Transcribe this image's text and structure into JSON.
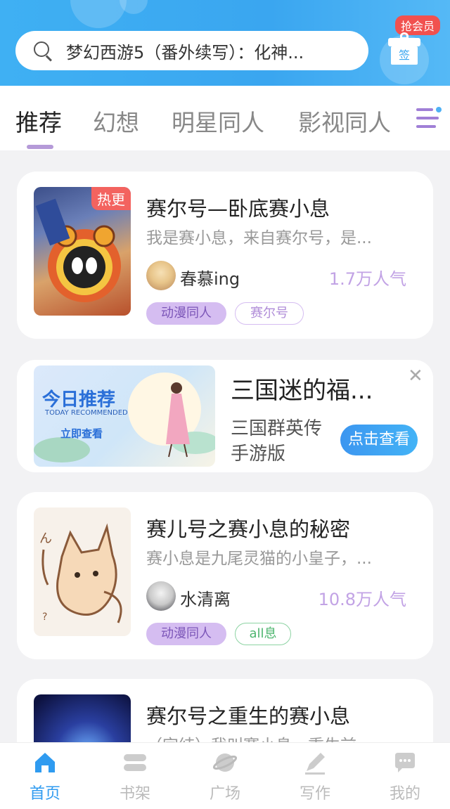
{
  "header": {
    "search_text": "梦幻西游5（番外续写）：化神...",
    "vip_badge": "抢会员",
    "sign_label": "签"
  },
  "tabs": [
    {
      "label": "推荐",
      "active": true
    },
    {
      "label": "幻想",
      "active": false
    },
    {
      "label": "明星同人",
      "active": false
    },
    {
      "label": "影视同人",
      "active": false
    }
  ],
  "books": [
    {
      "title": "赛尔号—卧底赛小息",
      "desc": "我是赛小息，来自赛尔号，是...",
      "badge": "热更",
      "author": "春慕ing",
      "popularity": "1.7万人气",
      "tags": [
        "动漫同人",
        "赛尔号"
      ]
    },
    {
      "title": "赛儿号之赛小息的秘密",
      "desc": "赛小息是九尾灵猫的小皇子，...",
      "author": "水清离",
      "popularity": "10.8万人气",
      "tags": [
        "动漫同人",
        "all息"
      ]
    },
    {
      "title": "赛尔号之重生的赛小息",
      "desc": "（完结）我叫赛小息，重生前..."
    }
  ],
  "ad": {
    "banner_title": "今日推荐",
    "banner_subtitle": "TODAY RECOMMENDED",
    "banner_cta": "立即查看",
    "title": "三国迷的福...",
    "subtitle": "三国群英传手游版",
    "button": "点击查看",
    "close": "✕"
  },
  "bottom_nav": [
    {
      "label": "首页",
      "icon": "home-icon",
      "active": true
    },
    {
      "label": "书架",
      "icon": "bookshelf-icon",
      "active": false
    },
    {
      "label": "广场",
      "icon": "planet-icon",
      "active": false
    },
    {
      "label": "写作",
      "icon": "pen-icon",
      "active": false
    },
    {
      "label": "我的",
      "icon": "chat-icon",
      "active": false
    }
  ],
  "colors": {
    "header": "#3aa6f0",
    "accent_purple": "#c2a3e5",
    "nav_active": "#2f9bf0"
  }
}
